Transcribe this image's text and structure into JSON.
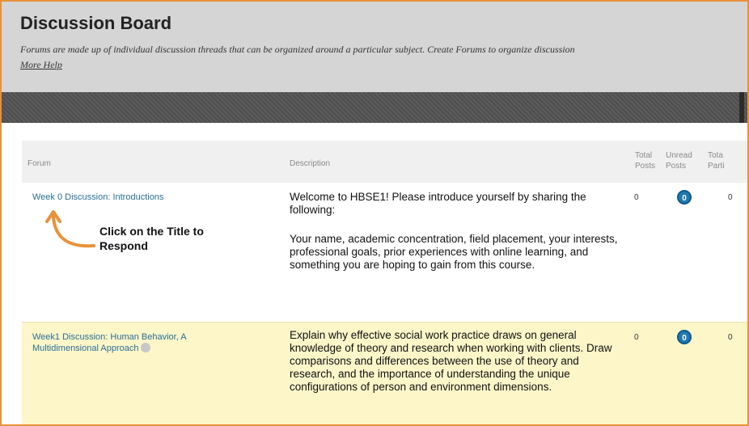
{
  "header": {
    "title": "Discussion Board",
    "intro": "Forums are made up of individual discussion threads that can be organized around a particular subject. Create Forums to organize discussion",
    "more_help": "More Help"
  },
  "table": {
    "columns": {
      "forum": "Forum",
      "description": "Description",
      "total_posts": "Total Posts",
      "unread_posts": "Unread Posts",
      "participants": "Tota Parti"
    },
    "rows": [
      {
        "forum": "Week 0 Discussion: Introductions",
        "description_1": "Welcome to HBSE1! Please introduce yourself by sharing the following:",
        "description_2": "Your name, academic concentration, field placement, your interests, professional goals, prior experiences with online learning, and something you are hoping to gain from this course.",
        "total_posts": "0",
        "unread_posts": "0",
        "participants": "0"
      },
      {
        "forum": "Week1 Discussion: Human Behavior, A Multidimensional Approach",
        "description_1": "Explain why effective social work practice draws on general knowledge of theory and research when working with clients. Draw comparisons and differences between the use of theory and research, and the importance of understanding the unique configurations of person and environment dimensions.",
        "total_posts": "0",
        "unread_posts": "0",
        "participants": "0"
      }
    ]
  },
  "annotation": {
    "text": "Click on the Title to Respond"
  },
  "colors": {
    "frame_border": "#e8913a",
    "link": "#2a6f97",
    "badge": "#1f79b0",
    "highlight_row": "#fcf6c9",
    "arrow": "#e8913a"
  }
}
